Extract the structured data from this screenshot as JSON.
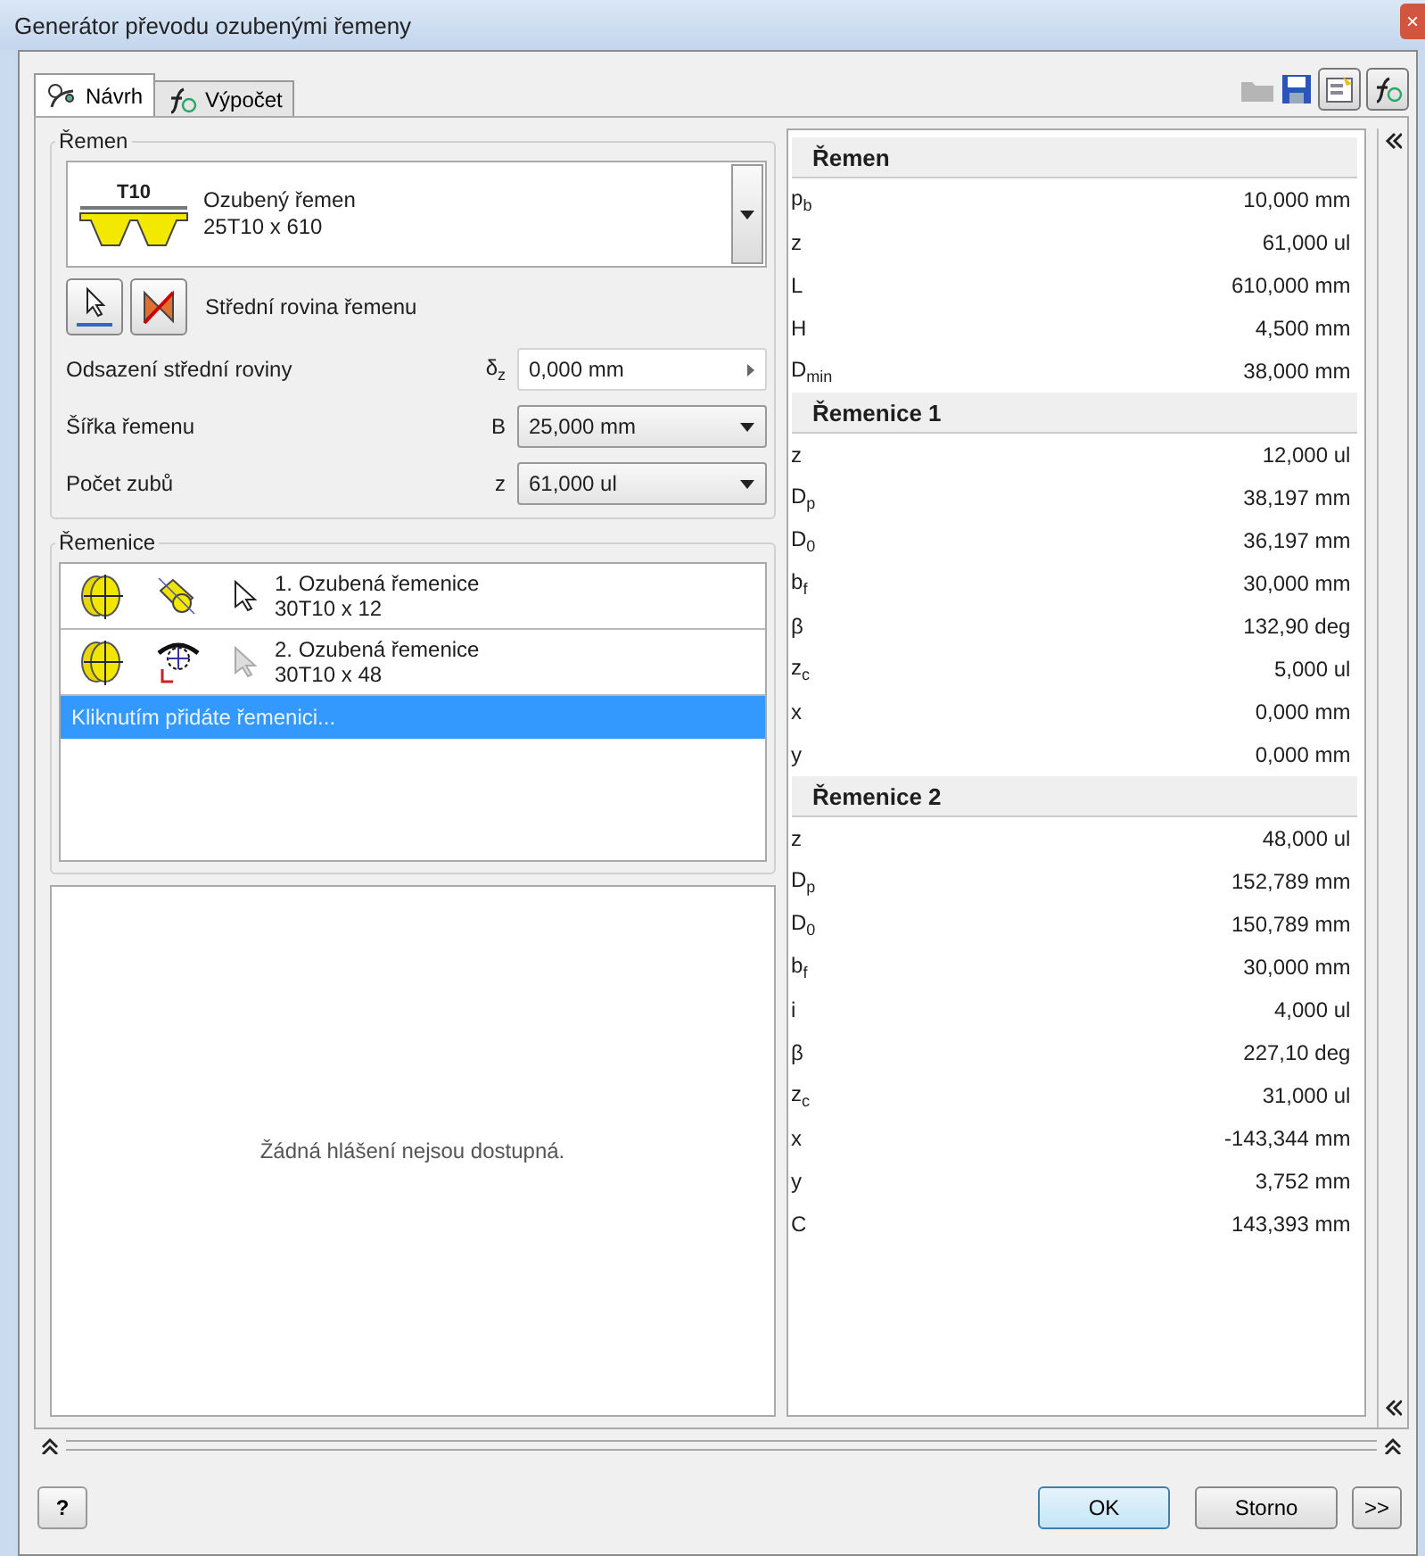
{
  "window": {
    "title": "Generátor převodu ozubenými řemeny",
    "close": "×"
  },
  "tabs": [
    {
      "label": "Návrh",
      "selected": true,
      "kind": "design"
    },
    {
      "label": "Výpočet",
      "selected": false,
      "kind": "calc"
    }
  ],
  "toolbar": {
    "toggles": [
      {
        "selected": true
      },
      {
        "selected": true
      }
    ]
  },
  "belt": {
    "title": "Řemen",
    "badge": "T10",
    "name": "Ozubený řemen",
    "spec": "25T10 x 610",
    "plane_label": "Střední rovina řemenu",
    "fields": [
      {
        "label": "Odsazení střední roviny",
        "symbol": "δ$_{z}$",
        "value": "0,000 mm",
        "kind": "spin"
      },
      {
        "label": "Šířka řemenu",
        "symbol": "B",
        "value": "25,000 mm",
        "kind": "dropdown"
      },
      {
        "label": "Počet zubů",
        "symbol": "z",
        "value": "61,000 ul",
        "kind": "dropdown"
      }
    ]
  },
  "pulleys": {
    "title": "Řemenice",
    "items": [
      {
        "name": "1. Ozubená řemenice",
        "spec": "30T10 x 12",
        "kind": "coaxial",
        "disabled": false
      },
      {
        "name": "2. Ozubená řemenice",
        "spec": "30T10 x 48",
        "kind": "tangent",
        "disabled": true
      }
    ],
    "add_row": {
      "label": "Kliknutím přidáte řemenici...",
      "selected": true
    }
  },
  "messages": {
    "text": "Žádná hlášení nejsou dostupná."
  },
  "results": [
    {
      "title": "Řemen",
      "rows": [
        {
          "symbol": "p$_{b}$",
          "value": "10,000 mm"
        },
        {
          "symbol": "z",
          "value": "61,000 ul"
        },
        {
          "symbol": "L",
          "value": "610,000 mm"
        },
        {
          "symbol": "H",
          "value": "4,500 mm"
        },
        {
          "symbol": "D$_{min}$",
          "value": "38,000 mm"
        }
      ]
    },
    {
      "title": "Řemenice 1",
      "rows": [
        {
          "symbol": "z",
          "value": "12,000 ul"
        },
        {
          "symbol": "D$_{p}$",
          "value": "38,197 mm"
        },
        {
          "symbol": "D$_{0}$",
          "value": "36,197 mm"
        },
        {
          "symbol": "b$_{f}$",
          "value": "30,000 mm"
        },
        {
          "symbol": "β",
          "value": "132,90 deg"
        },
        {
          "symbol": "z$_{c}$",
          "value": "5,000 ul"
        },
        {
          "symbol": "x",
          "value": "0,000 mm"
        },
        {
          "symbol": "y",
          "value": "0,000 mm"
        }
      ]
    },
    {
      "title": "Řemenice 2",
      "rows": [
        {
          "symbol": "z",
          "value": "48,000 ul"
        },
        {
          "symbol": "D$_{p}$",
          "value": "152,789 mm"
        },
        {
          "symbol": "D$_{0}$",
          "value": "150,789 mm"
        },
        {
          "symbol": "b$_{f}$",
          "value": "30,000 mm"
        },
        {
          "symbol": "i",
          "value": "4,000 ul"
        },
        {
          "symbol": "β",
          "value": "227,10 deg"
        },
        {
          "symbol": "z$_{c}$",
          "value": "31,000 ul"
        },
        {
          "symbol": "x",
          "value": "-143,344 mm"
        },
        {
          "symbol": "y",
          "value": "3,752 mm"
        },
        {
          "symbol": "C",
          "value": "143,393 mm"
        }
      ]
    }
  ],
  "footer": {
    "help": "?",
    "ok": "OK",
    "cancel": "Storno",
    "more": ">>"
  }
}
